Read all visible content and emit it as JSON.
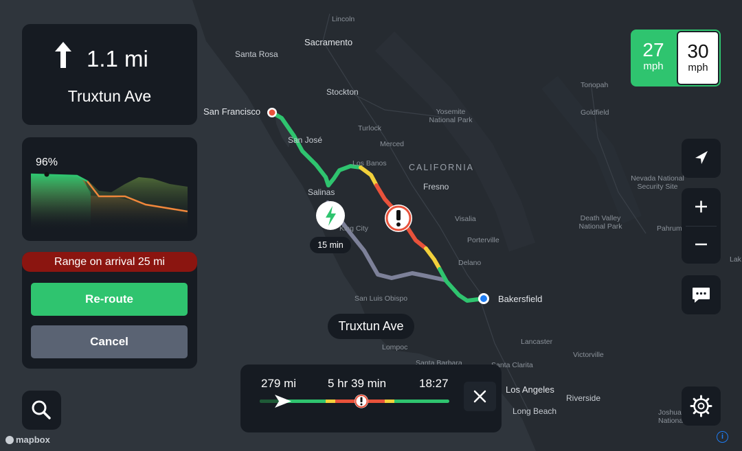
{
  "maneuver": {
    "distance": "1.1 mi",
    "street": "Truxtun Ave",
    "icon": "arrow-up-icon"
  },
  "elevation": {
    "battery_percent_label": "96%"
  },
  "range": {
    "banner": "Range on arrival 25 mi",
    "reroute_label": "Re-route",
    "cancel_label": "Cancel"
  },
  "speed": {
    "current": "27",
    "current_unit": "mph",
    "limit": "30",
    "limit_unit": "mph"
  },
  "trip": {
    "distance": "279 mi",
    "duration": "5 hr 39 min",
    "arrival": "18:27"
  },
  "callout": {
    "street": "Truxtun Ave"
  },
  "charger": {
    "duration": "15 min"
  },
  "attribution": {
    "brand": "mapbox"
  },
  "map_labels": {
    "lincoln": "Lincoln",
    "sacramento": "Sacramento",
    "santa_rosa": "Santa Rosa",
    "stockton": "Stockton",
    "san_francisco": "San Francisco",
    "san_jose": "San José",
    "turlock": "Turlock",
    "yosemite_1": "Yosemite",
    "yosemite_2": "National Park",
    "merced": "Merced",
    "los_banos": "Los Banos",
    "california": "CALIFORNIA",
    "fresno": "Fresno",
    "salinas": "Salinas",
    "king_city": "King City",
    "visalia": "Visalia",
    "porterville": "Porterville",
    "delano": "Delano",
    "bakersfield": "Bakersfield",
    "san_luis_obispo": "San Luis Obispo",
    "lompoc": "Lompoc",
    "santa_barbara": "Santa Barbara",
    "santa_clarita": "Santa Clarita",
    "lancaster": "Lancaster",
    "victorville": "Victorville",
    "los_angeles": "Los Angeles",
    "riverside": "Riverside",
    "long_beach": "Long Beach",
    "tonopah": "Tonopah",
    "goldfield": "Goldfield",
    "nevada_1": "Nevada National",
    "nevada_2": "Security Site",
    "death_valley_1": "Death Valley",
    "death_valley_2": "National Park",
    "pahrump": "Pahrump",
    "lake": "Lak",
    "joshua_1": "Joshua",
    "joshua_2": "Nationa"
  },
  "colors": {
    "green": "#2fc46f",
    "yellow": "#f2d03b",
    "red": "#e8523b",
    "alt_route": "#7d8199",
    "panel": "#161b22",
    "banner": "#8b1510",
    "cancel": "#5a6373"
  }
}
